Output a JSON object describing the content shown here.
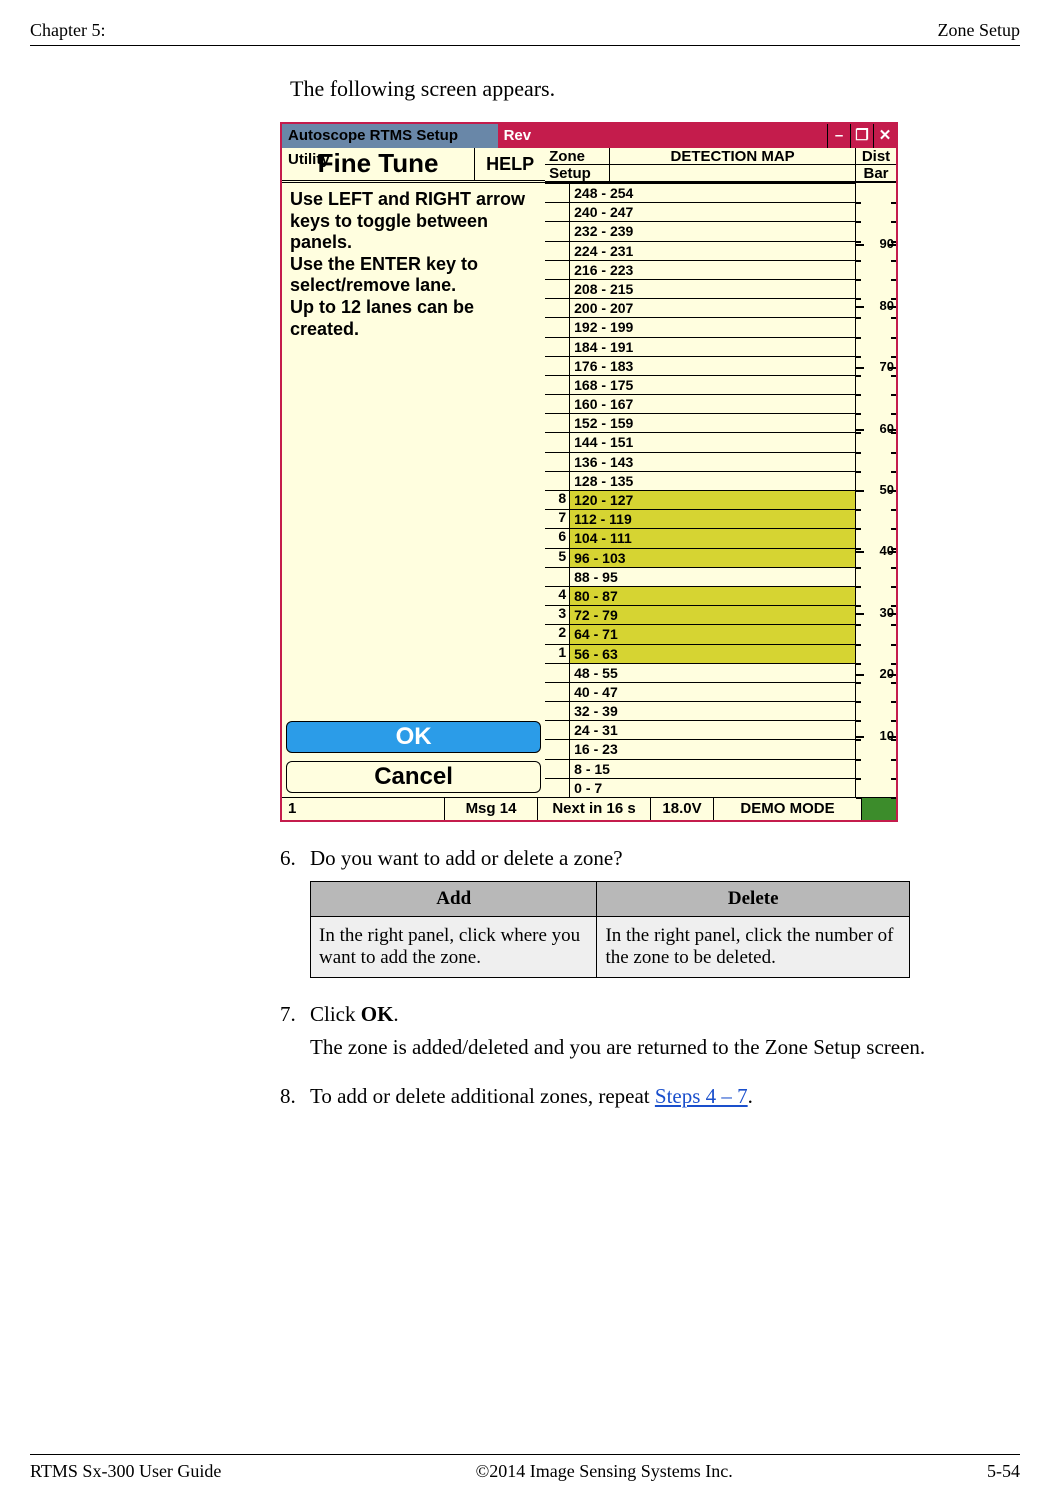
{
  "header": {
    "left": "Chapter 5:",
    "right": "Zone Setup"
  },
  "intro": "The following screen appears.",
  "ui": {
    "title_left": "Autoscope RTMS Setup Utility",
    "title_rev": "Rev",
    "win_min": "–",
    "win_max": "❐",
    "win_close": "✕",
    "fine_tune": "Fine Tune",
    "help": "HELP",
    "zone_lbl": "Zone",
    "setup_lbl": "Setup",
    "detmap": "DETECTION MAP",
    "dist_lbl": "Dist",
    "bar_lbl": "Bar",
    "instr": "Use LEFT and RIGHT arrow keys to toggle between panels.\nUse the ENTER key to select/remove lane.\nUp to 12 lanes can be created.",
    "ok": "OK",
    "cancel": "Cancel",
    "ranges": [
      "0 - 7",
      "8 - 15",
      "16 - 23",
      "24 - 31",
      "32 - 39",
      "40 - 47",
      "48 - 55",
      "56 - 63",
      "64 - 71",
      "72 - 79",
      "80 - 87",
      "88 - 95",
      "96 - 103",
      "104 - 111",
      "112 - 119",
      "120 - 127",
      "128 - 135",
      "136 - 143",
      "144 - 151",
      "152 - 159",
      "160 - 167",
      "168 - 175",
      "176 - 183",
      "184 - 191",
      "192 - 199",
      "200 - 207",
      "208 - 215",
      "216 - 223",
      "224 - 231",
      "232 - 239",
      "240 - 247",
      "248 - 254"
    ],
    "sel": {
      "7": "1",
      "8": "2",
      "9": "3",
      "10": "4",
      "12": "5",
      "13": "6",
      "14": "7",
      "15": "8"
    },
    "dist_ticks": [
      "10",
      "20",
      "30",
      "40",
      "50",
      "60",
      "70",
      "80",
      "90"
    ],
    "status": {
      "s0": "1",
      "s1": "Msg 14",
      "s2": "Next in 16 s",
      "s3": "18.0V",
      "s4": "DEMO MODE"
    }
  },
  "steps": {
    "six": {
      "num": "6.",
      "txt": "Do you want to add or delete a zone?"
    },
    "table": {
      "h1": "Add",
      "h2": "Delete",
      "c1": "In the right panel, click where you want to add the zone.",
      "c2": "In the right panel, click the number of the zone to be deleted."
    },
    "seven": {
      "num": "7.",
      "txt_a": "Click ",
      "bold": "OK",
      "txt_b": "."
    },
    "seven_sub": "The zone is added/deleted and you are returned to the Zone Setup screen.",
    "eight": {
      "num": "8.",
      "txt": "To add or delete additional zones, repeat ",
      "link": "Steps 4 – 7",
      "txt2": "."
    }
  },
  "footer": {
    "left": "RTMS Sx-300 User Guide",
    "center": "©2014 Image Sensing Systems Inc.",
    "right": "5-54"
  }
}
